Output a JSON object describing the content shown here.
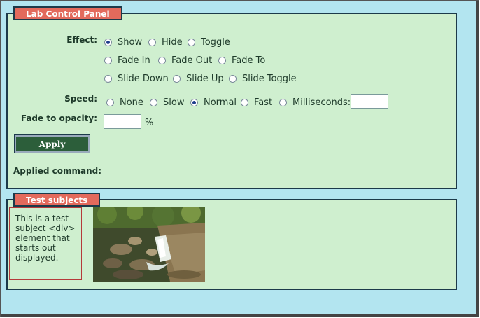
{
  "control_panel": {
    "legend": "Lab Control Panel",
    "effect_label": "Effect:",
    "effects": [
      {
        "label": "Show",
        "checked": true
      },
      {
        "label": "Hide",
        "checked": false
      },
      {
        "label": "Toggle",
        "checked": false
      },
      {
        "label": "Fade In",
        "checked": false
      },
      {
        "label": "Fade Out",
        "checked": false
      },
      {
        "label": "Fade To",
        "checked": false
      },
      {
        "label": "Slide Down",
        "checked": false
      },
      {
        "label": "Slide Up",
        "checked": false
      },
      {
        "label": "Slide Toggle",
        "checked": false
      }
    ],
    "speed_label": "Speed:",
    "speeds": [
      {
        "label": "None",
        "checked": false
      },
      {
        "label": "Slow",
        "checked": false
      },
      {
        "label": "Normal",
        "checked": true
      },
      {
        "label": "Fast",
        "checked": false
      },
      {
        "label": "Milliseconds:",
        "checked": false
      }
    ],
    "milliseconds_value": "",
    "opacity_label": "Fade to opacity:",
    "opacity_value": "",
    "opacity_unit": "%",
    "apply_label": "Apply",
    "applied_label": "Applied command:",
    "applied_value": ""
  },
  "test_subjects": {
    "legend": "Test subjects",
    "subject_text": "This is a test subject <div> element that starts out displayed.",
    "photo_icon": "waterfall-photo"
  },
  "colors": {
    "window_bg": "#b3e5f0",
    "panel_bg": "#cfefcf",
    "legend_bg": "#e36a5c",
    "apply_bg": "#2c5e3a"
  }
}
